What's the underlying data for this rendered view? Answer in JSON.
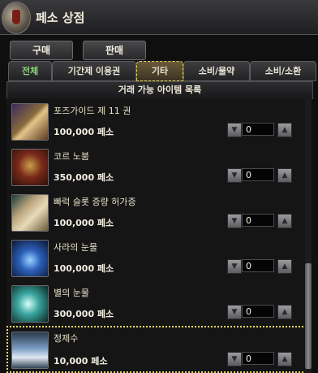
{
  "window": {
    "title": "페소 상점"
  },
  "mode_buttons": {
    "buy": "구매",
    "sell": "판매"
  },
  "tabs": [
    {
      "label": "전체"
    },
    {
      "label": "기간제 이용권"
    },
    {
      "label": "기타"
    },
    {
      "label": "소비/물약"
    },
    {
      "label": "소비/소환"
    }
  ],
  "active_tab": "기타",
  "list": {
    "header": "거래 가능 아이템 목록",
    "items": [
      {
        "name": "포즈가이드 제 11 권",
        "price": "100,000 페소",
        "qty": "0",
        "icon": "book-icon",
        "color": "#8a6a3a"
      },
      {
        "name": "코르 노붐",
        "price": "350,000 페소",
        "qty": "0",
        "icon": "demon-icon",
        "color": "#7a2a1a"
      },
      {
        "name": "빠럭 슬롯 증량 허가증",
        "price": "100,000 페소",
        "qty": "0",
        "icon": "scroll-icon",
        "color": "#b7a27a"
      },
      {
        "name": "사라의 눈물",
        "price": "100,000 페소",
        "qty": "0",
        "icon": "blue-gem-icon",
        "color": "#2b5fb8"
      },
      {
        "name": "별의 눈물",
        "price": "300,000 페소",
        "qty": "0",
        "icon": "teal-gem-icon",
        "color": "#3aa6a0"
      },
      {
        "name": "정제수",
        "price": "10,000 페소",
        "qty": "0",
        "icon": "potion-bottle-icon",
        "color": "#7a9cc4"
      }
    ]
  }
}
